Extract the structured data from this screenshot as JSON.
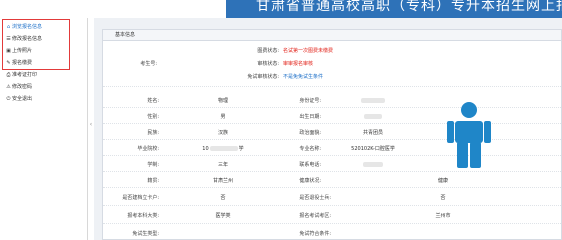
{
  "header": {
    "title": "甘肃省普通高校高职（专科）专升本招生网上报名"
  },
  "sidebar": {
    "items": [
      {
        "icon": "home-icon",
        "glyph": "⌂",
        "label": "浏览报名信息"
      },
      {
        "icon": "list-icon",
        "glyph": "☰",
        "label": "修改报名信息"
      },
      {
        "icon": "image-icon",
        "glyph": "▣",
        "label": "上传照片"
      },
      {
        "icon": "pencil-icon",
        "glyph": "✎",
        "label": "报名缴费"
      },
      {
        "icon": "printer-icon",
        "glyph": "⎙",
        "label": "准考证打印"
      },
      {
        "icon": "warning-icon",
        "glyph": "⚠",
        "label": "修改密码"
      },
      {
        "icon": "power-icon",
        "glyph": "⏻",
        "label": "安全退出"
      }
    ]
  },
  "panel": {
    "title": "基本信息"
  },
  "status": {
    "exam_no_label": "考生号:",
    "pic_label": "图费状态:",
    "pic_value": "名试第一次图费未缴费",
    "review_label": "审核状态:",
    "review_value": "审审报名审核",
    "exempt_label": "免试审核状态:",
    "exempt_value": "不是免免试生条件"
  },
  "rows": [
    {
      "l1": "姓名:",
      "v1": "物理",
      "l2": "身份证号:",
      "v2": ""
    },
    {
      "l1": "性别:",
      "v1": "男",
      "l2": "出生日期:",
      "v2": ""
    },
    {
      "l1": "民族:",
      "v1": "汉族",
      "l2": "政治面貌:",
      "v2": "共青团员"
    },
    {
      "l1": "毕业院校:",
      "v1": "10",
      "v1b": "学",
      "l2": "专业名称:",
      "v2": "520102K-口腔医学"
    },
    {
      "l1": "学制:",
      "v1": "三年",
      "l2": "联系电话:",
      "v2": ""
    },
    {
      "l1": "籍贯:",
      "v1": "甘肃兰州",
      "l2": "健康状况:",
      "v2": "健康"
    },
    {
      "l1": "是否建档立卡户:",
      "v1": "否",
      "l2": "是否退役士兵:",
      "v2": "否"
    },
    {
      "l1": "报考本科大类:",
      "v1": "医学类",
      "l2": "报名考试考区:",
      "v2": "兰州市"
    },
    {
      "l1": "免试生类型:",
      "v1": "",
      "l2": "免试符合条件:",
      "v2": ""
    }
  ],
  "colors": {
    "banner": "#2e72b8",
    "accent": "#1c6fc8",
    "alert": "#e2231a",
    "silhouette": "#1f86c8"
  }
}
